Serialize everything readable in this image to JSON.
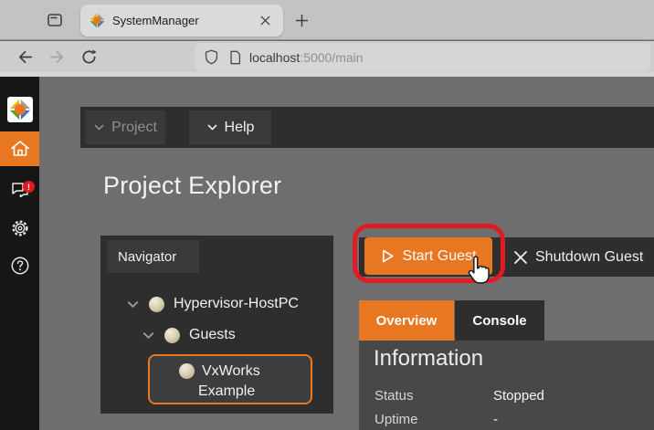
{
  "browser": {
    "tab_title": "SystemManager",
    "url": {
      "host": "localhost",
      "path": ":5000/main"
    }
  },
  "menubar": {
    "project_label": "Project",
    "help_label": "Help"
  },
  "page_title": "Project Explorer",
  "sidebar": {
    "notification_badge": "!"
  },
  "navigator": {
    "header_label": "Navigator",
    "items": [
      {
        "label": "Hypervisor-HostPC",
        "expanded": true
      },
      {
        "label": "Guests",
        "expanded": true
      },
      {
        "line1": "VxWorks",
        "line2": "Example",
        "selected": true
      }
    ]
  },
  "toolbar": {
    "start_label": "Start Guest",
    "shutdown_label": "Shutdown Guest"
  },
  "tabs": [
    {
      "label": "Overview",
      "active": true
    },
    {
      "label": "Console",
      "active": false
    }
  ],
  "overview": {
    "heading": "Information",
    "rows": [
      {
        "label": "Status",
        "value": "Stopped"
      },
      {
        "label": "Uptime",
        "value": "-"
      }
    ]
  },
  "colors": {
    "accent_orange": "#e87722",
    "annotation_red": "#e01b24",
    "badge_red": "#e01b24",
    "panel_dark": "#2e2e2e",
    "page_background": "#6e6e6e"
  }
}
